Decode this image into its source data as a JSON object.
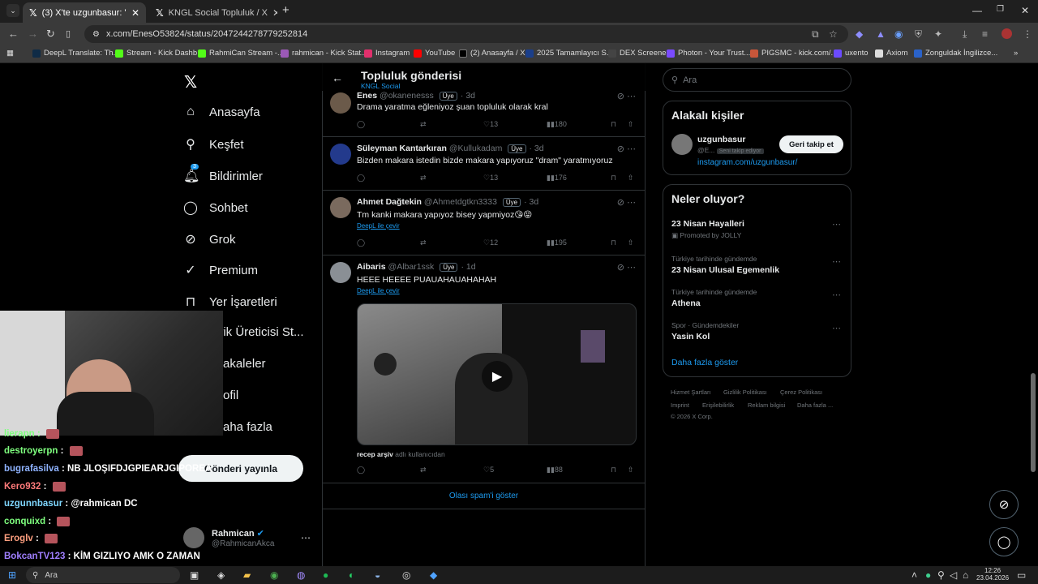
{
  "browser": {
    "tabs": [
      {
        "label": "(3) X'te uzgunbasur: \"Bahsettiğ",
        "active": true
      },
      {
        "label": "KNGL Social Topluluk / X",
        "active": false
      }
    ],
    "url": "x.com/EnesO53824/status/2047244278779252814",
    "bookmarks": [
      "DeepL Translate: Th...",
      "Stream - Kick Dashb...",
      "RahmiCan Stream -...",
      "rahmican - Kick Stat...",
      "Instagram",
      "YouTube",
      "(2) Anasayfa / X",
      "2025 Tamamlayıcı S...",
      "DEX Screener",
      "Photon - Your Trust...",
      "PIGSMC - kick.com/...",
      "uxento",
      "Axiom",
      "Zonguldak İngilizce..."
    ]
  },
  "nav": {
    "items": [
      "Anasayfa",
      "Keşfet",
      "Bildirimler",
      "Sohbet",
      "Grok",
      "Premium",
      "Yer İşaretleri",
      "erik Üreticisi St...",
      "akaleler",
      "ofil",
      "aha fazla"
    ],
    "notif_count": "3",
    "post_button": "Gönderi yayınla",
    "account": {
      "name": "Rahmican",
      "handle": "@RahmicanAkca"
    }
  },
  "chat": [
    {
      "user": "destroyerpn",
      "msg": "",
      "color": "#7fff7f"
    },
    {
      "user": "bugrafasilva",
      "msg": "NB JLOŞIFDJGPIEARJGIPOREA",
      "color": "#8fb3ff"
    },
    {
      "user": "Kero932",
      "msg": "",
      "color": "#ff7b7b"
    },
    {
      "user": "uzgunnbasur",
      "msg": "@rahmican DC",
      "color": "#7fd7ff"
    },
    {
      "user": "conquixd",
      "msg": "",
      "color": "#7fff7f"
    },
    {
      "user": "Eroglv",
      "msg": "",
      "color": "#ff9f7f"
    },
    {
      "user": "BokcanTV123",
      "msg": "KİM GIZLIYO AMK O ZAMAN",
      "color": "#a07fff"
    }
  ],
  "header": {
    "title": "Topluluk gönderisi",
    "subtitle": "KNGL Social"
  },
  "tweets": [
    {
      "name": "Enes",
      "handle": "@okanenesss",
      "badge": "Üye",
      "time": "3d",
      "text": "Drama yaratma eğleniyoz şuan topluluk olarak kral",
      "likes": "13",
      "views": "180"
    },
    {
      "name": "Süleyman Kantarkıran",
      "handle": "@Kullukadam",
      "badge": "Üye",
      "time": "3d",
      "text": "Bizden makara istedin bizde makara yapıyoruz \"dram\" yaratmıyoruz",
      "likes": "13",
      "views": "176"
    },
    {
      "name": "Ahmet Dağtekin",
      "handle": "@Ahmetdgtkn3333",
      "badge": "Üye",
      "time": "3d",
      "text": "Tm kanki makara yapıyoz bisey yapmiyoz😘😝",
      "translate": "DeepL ile çevir",
      "likes": "12",
      "views": "195"
    },
    {
      "name": "Aibaris",
      "handle": "@Albar1ssk",
      "badge": "Üye",
      "time": "1d",
      "text": "HEEE HEEEE PUAUAHAUAHAHAH",
      "translate": "DeepL ile çevir",
      "media_caption": "recep arşiv",
      "media_caption_sub": "adlı kullanıcıdan",
      "likes": "5",
      "views": "88"
    }
  ],
  "spam_link": "Olası spam'i göster",
  "right": {
    "search_placeholder": "Ara",
    "relevant_title": "Alakalı kişiler",
    "person": {
      "name": "uzgunbasur",
      "handle": "@E...",
      "follow_tag": "Seni takip ediyor",
      "link": "instagram.com/uzgunbasur/",
      "button": "Geri takip et"
    },
    "trends_title": "Neler oluyor?",
    "trends": [
      {
        "sub": "",
        "name": "23 Nisan Hayalleri",
        "promo": "Promoted by JOLLY"
      },
      {
        "sub": "Türkiye tarihinde gündemde",
        "name": "23 Nisan Ulusal Egemenlik"
      },
      {
        "sub": "Türkiye tarihinde gündemde",
        "name": "Athena"
      },
      {
        "sub": "Spor · Gündemdekiler",
        "name": "Yasin Kol"
      }
    ],
    "show_more": "Daha fazla göster",
    "footer": [
      "Hizmet Şartları",
      "Gizlilik Politikası",
      "Çerez Politikası",
      "Imprint",
      "Erişilebilirlik",
      "Reklam bilgisi",
      "Daha fazla ...",
      "© 2026 X Corp."
    ]
  },
  "taskbar": {
    "search": "Ara",
    "time": "12:26",
    "date": "23.04.2026"
  },
  "colors": {
    "accent": "#1d9bf0",
    "bg": "#000000",
    "border": "#2f3336"
  }
}
